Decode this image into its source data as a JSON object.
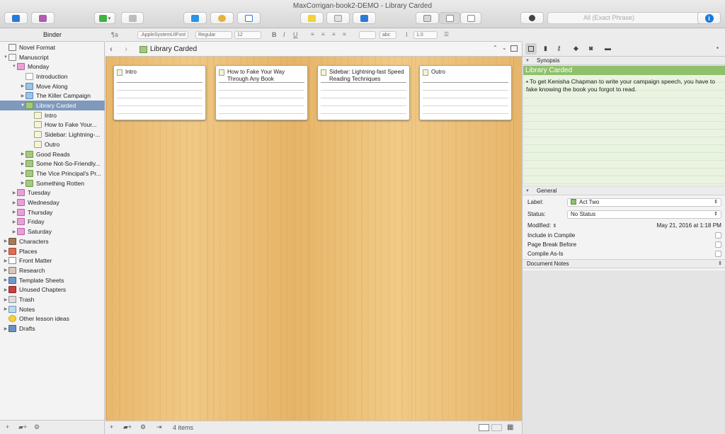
{
  "window": {
    "title": "MaxCorrigan-book2-DEMO - Library Carded"
  },
  "toolbar": {
    "search_placeholder": "All (Exact Phrase)",
    "info_label": "i",
    "accent": "#1a7ad8"
  },
  "formatbar": {
    "style_label": "¶a",
    "font_family": ".AppleSystemUIFont",
    "font_weight": "Regular",
    "font_size": "12",
    "bold": "B",
    "italic": "I",
    "underline": "U",
    "spacing_label": "abc",
    "line_spacing": "1.0"
  },
  "binder": {
    "title": "Binder",
    "items": [
      {
        "label": "Novel Format",
        "icon": "novel-format-icon"
      },
      {
        "label": "Manuscript",
        "icon": "manuscript-icon"
      },
      {
        "label": "Monday",
        "icon": "folder-icon"
      },
      {
        "label": "Introduction",
        "icon": "document-icon"
      },
      {
        "label": "Move Along",
        "icon": "folder-icon"
      },
      {
        "label": "The Killer Campaign",
        "icon": "folder-icon"
      },
      {
        "label": "Library Carded",
        "icon": "folder-icon"
      },
      {
        "label": "Intro",
        "icon": "document-icon"
      },
      {
        "label": "How to Fake Your...",
        "icon": "document-icon"
      },
      {
        "label": "Sidebar: Lightning-...",
        "icon": "document-icon"
      },
      {
        "label": "Outro",
        "icon": "document-icon"
      },
      {
        "label": "Good Reads",
        "icon": "folder-icon"
      },
      {
        "label": "Some Not-So-Friendly...",
        "icon": "folder-icon"
      },
      {
        "label": "The Vice Principal's Pr...",
        "icon": "folder-icon"
      },
      {
        "label": "Something Rotten",
        "icon": "folder-icon"
      },
      {
        "label": "Tuesday",
        "icon": "folder-icon"
      },
      {
        "label": "Wednesday",
        "icon": "folder-icon"
      },
      {
        "label": "Thursday",
        "icon": "folder-icon"
      },
      {
        "label": "Friday",
        "icon": "folder-icon"
      },
      {
        "label": "Saturday",
        "icon": "folder-icon"
      },
      {
        "label": "Characters",
        "icon": "characters-icon"
      },
      {
        "label": "Places",
        "icon": "places-icon"
      },
      {
        "label": "Front Matter",
        "icon": "front-matter-icon"
      },
      {
        "label": "Research",
        "icon": "research-icon"
      },
      {
        "label": "Template Sheets",
        "icon": "template-icon"
      },
      {
        "label": "Unused Chapters",
        "icon": "book-icon"
      },
      {
        "label": "Trash",
        "icon": "trash-icon"
      },
      {
        "label": "Notes",
        "icon": "notes-icon"
      },
      {
        "label": "Other lesson ideas",
        "icon": "lightbulb-icon"
      },
      {
        "label": "Drafts",
        "icon": "drafts-icon"
      }
    ]
  },
  "editor": {
    "header_title": "Library Carded",
    "cards": [
      {
        "title": "Intro"
      },
      {
        "title": "How to Fake Your Way Through Any Book"
      },
      {
        "title": "Sidebar: Lightning-fast Speed Reading Techniques"
      },
      {
        "title": "Outro"
      }
    ],
    "footer_count": "4 items"
  },
  "inspector": {
    "synopsis_label": "Synopsis",
    "synopsis_title": "Library Carded",
    "synopsis_text": "• To get Kenisha Chapman to write your campaign speech, you have to fake knowing the book you forgot to read.",
    "general_label": "General",
    "label_label": "Label:",
    "label_value": "Act Two",
    "label_color": "#8fc06b",
    "status_label": "Status:",
    "status_value": "No Status",
    "modified_label": "Modified:",
    "modified_value": "May 21, 2016 at 1:18 PM",
    "include_compile": "Include in Compile",
    "page_break": "Page Break Before",
    "compile_as_is": "Compile As-Is",
    "document_notes": "Document Notes"
  }
}
